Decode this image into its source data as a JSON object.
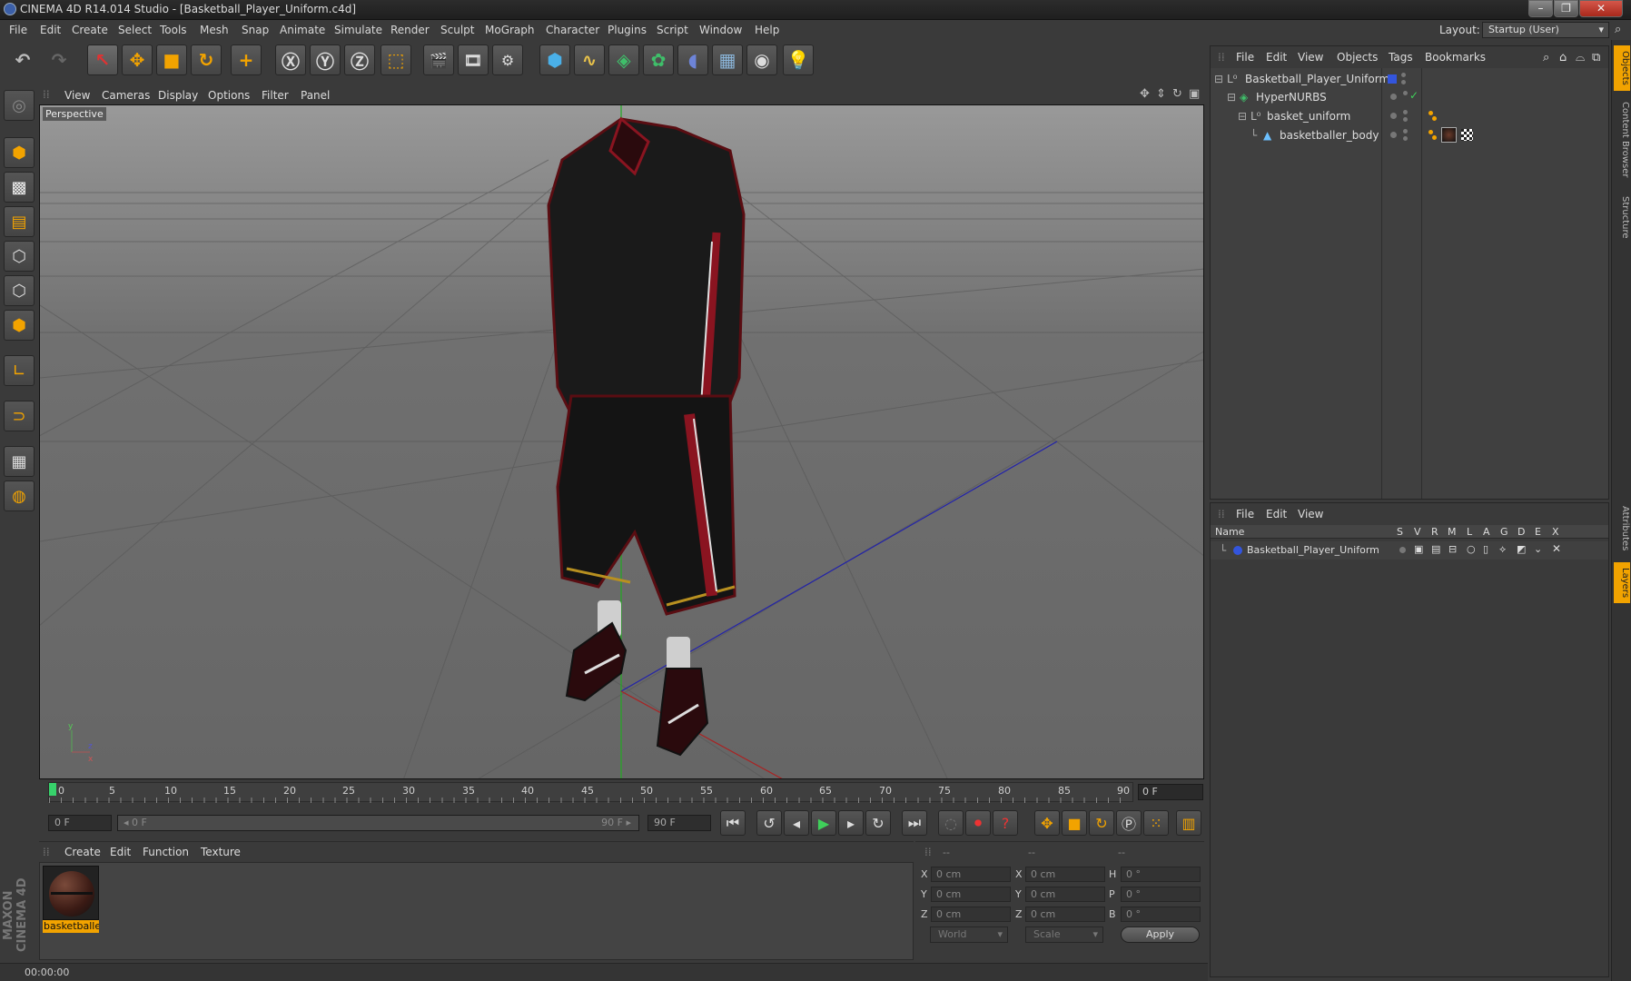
{
  "window": {
    "title": "CINEMA 4D R14.014 Studio - [Basketball_Player_Uniform.c4d]",
    "controls": [
      "–",
      "❐",
      "✕"
    ]
  },
  "menubar": {
    "items": [
      "File",
      "Edit",
      "Create",
      "Select",
      "Tools",
      "Mesh",
      "Snap",
      "Animate",
      "Simulate",
      "Render",
      "Sculpt",
      "MoGraph",
      "Character",
      "Plugins",
      "Script",
      "Window",
      "Help"
    ],
    "layout_label": "Layout:",
    "layout_value": "Startup (User)"
  },
  "viewport": {
    "menu": [
      "View",
      "Cameras",
      "Display",
      "Options",
      "Filter",
      "Panel"
    ],
    "label": "Perspective"
  },
  "timeline": {
    "ticks": [
      "0",
      "5",
      "10",
      "15",
      "20",
      "25",
      "30",
      "35",
      "40",
      "45",
      "50",
      "55",
      "60",
      "65",
      "70",
      "75",
      "80",
      "85",
      "90"
    ],
    "end_field": "0 F"
  },
  "transport": {
    "current_frame": "0 F",
    "range_start": "◂ 0 F",
    "range_end": "90 F ▸",
    "max_frame": "90 F"
  },
  "material_manager": {
    "menu": [
      "Create",
      "Edit",
      "Function",
      "Texture"
    ],
    "material_name": "basketballe"
  },
  "coordinates": {
    "headers": [
      "--",
      "--",
      "--"
    ],
    "rows": [
      {
        "l1": "X",
        "v1": "0 cm",
        "l2": "X",
        "v2": "0 cm",
        "l3": "H",
        "v3": "0 °"
      },
      {
        "l1": "Y",
        "v1": "0 cm",
        "l2": "Y",
        "v2": "0 cm",
        "l3": "P",
        "v3": "0 °"
      },
      {
        "l1": "Z",
        "v1": "0 cm",
        "l2": "Z",
        "v2": "0 cm",
        "l3": "B",
        "v3": "0 °"
      }
    ],
    "coord_system": "World",
    "mode": "Scale",
    "apply": "Apply"
  },
  "objects_manager": {
    "menu": [
      "File",
      "Edit",
      "View",
      "Objects",
      "Tags",
      "Bookmarks"
    ],
    "objects": [
      "Basketball_Player_Uniform",
      "HyperNURBS",
      "basket_uniform",
      "basketballer_body"
    ]
  },
  "layers_manager": {
    "menu": [
      "File",
      "Edit",
      "View"
    ],
    "columns": [
      "Name",
      "S",
      "V",
      "R",
      "M",
      "L",
      "A",
      "G",
      "D",
      "E",
      "X"
    ],
    "layer_name": "Basketball_Player_Uniform"
  },
  "right_tabs": [
    "Objects",
    "Content Browser",
    "Structure",
    "Attributes",
    "Layers"
  ],
  "branding": "MAXON CINEMA 4D",
  "status": {
    "time": "00:00:00"
  },
  "colors": {
    "accent": "#f2a300",
    "layer_blue": "#3355dd",
    "axis_green": "#22aa22",
    "axis_blue": "#2222aa",
    "axis_red": "#aa2222"
  }
}
